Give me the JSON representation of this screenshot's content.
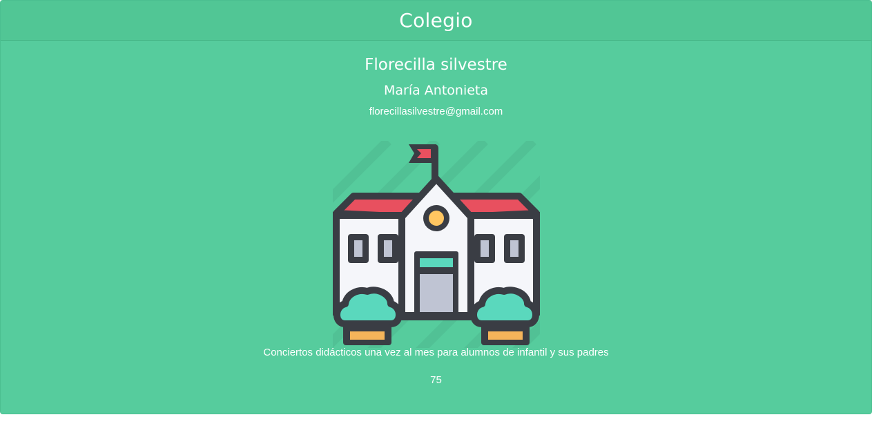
{
  "card": {
    "header_title": "Colegio",
    "school_name": "Florecilla silvestre",
    "contact_name": "María Antonieta",
    "email": "florecillasilvestre@gmail.com",
    "image_icon": "school-building-icon",
    "description": "Conciertos didácticos una vez al mes para alumnos de infantil y sus padres",
    "count": "75"
  },
  "colors": {
    "card_background": "#56cc9d",
    "header_background": "#51c695",
    "text": "#ffffff",
    "roof": "#e8505f",
    "outline": "#3a3d44",
    "wall": "#f5f6fa",
    "window_glass": "#bfc4d3",
    "bush": "#5ad8bd",
    "pot": "#f5b45a",
    "clock": "#ffc661"
  }
}
